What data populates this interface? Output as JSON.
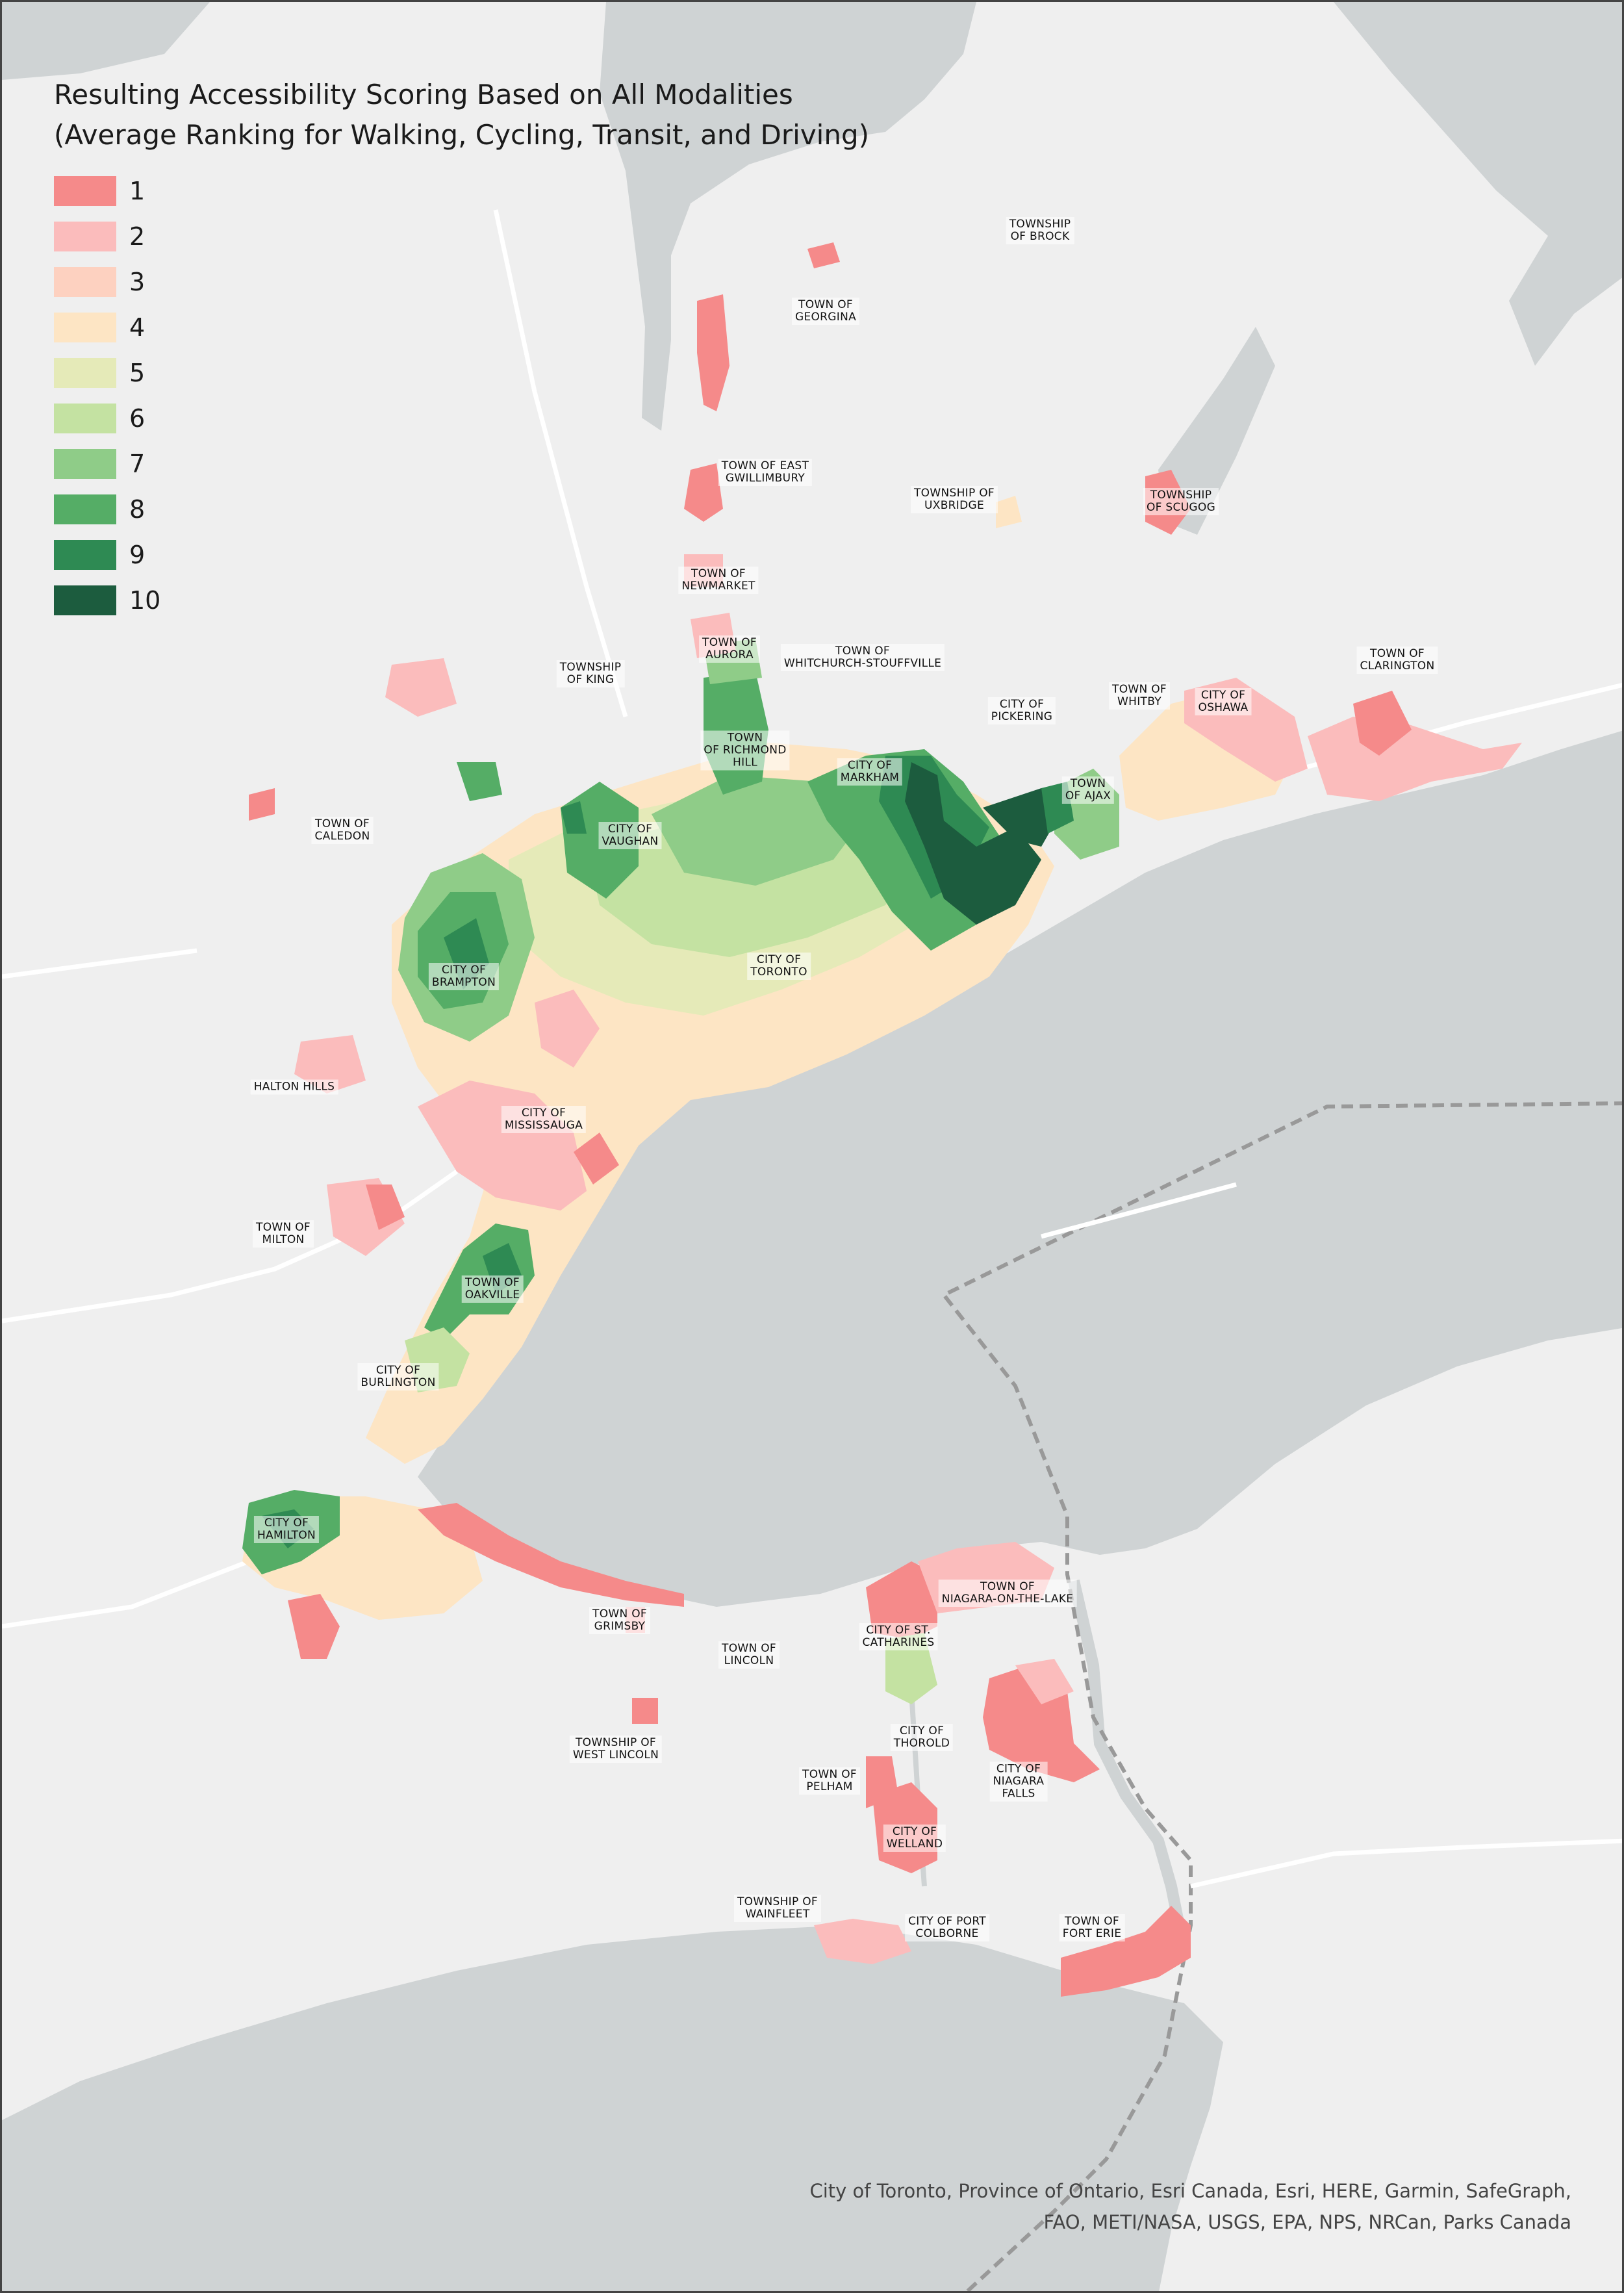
{
  "title": "Resulting Accessibility Scoring Based on All Modalities\n(Average Ranking for Walking, Cycling, Transit, and Driving)",
  "legend": [
    {
      "label": "1",
      "color": "#f58a8a"
    },
    {
      "label": "2",
      "color": "#fbbcbc"
    },
    {
      "label": "3",
      "color": "#fdd1c0"
    },
    {
      "label": "4",
      "color": "#fde5c4"
    },
    {
      "label": "5",
      "color": "#e5eab8"
    },
    {
      "label": "6",
      "color": "#c4e2a2"
    },
    {
      "label": "7",
      "color": "#8fcc88"
    },
    {
      "label": "8",
      "color": "#55ad66"
    },
    {
      "label": "9",
      "color": "#2e8a53"
    },
    {
      "label": "10",
      "color": "#1c5c3e"
    }
  ],
  "places": {
    "brock": "TOWNSHIP\nOF BROCK",
    "georgina": "TOWN OF\nGEORGINA",
    "east_gwillimbury": "TOWN OF EAST\nGWILLIMBURY",
    "uxbridge": "TOWNSHIP OF\nUXBRIDGE",
    "scugog": "TOWNSHIP\nOF SCUGOG",
    "newmarket": "TOWN OF\nNEWMARKET",
    "aurora": "TOWN OF\nAURORA",
    "whitchurch": "TOWN OF\nWHITCHURCH-STOUFFVILLE",
    "king": "TOWNSHIP\nOF KING",
    "clarington": "TOWN OF\nCLARINGTON",
    "whitby": "TOWN OF\nWHITBY",
    "oshawa": "CITY OF\nOSHAWA",
    "pickering": "CITY OF\nPICKERING",
    "richmond_hill": "TOWN\nOF RICHMOND\nHILL",
    "markham": "CITY OF\nMARKHAM",
    "ajax": "TOWN\nOF AJAX",
    "caledon": "TOWN OF\nCALEDON",
    "vaughan": "CITY OF\nVAUGHAN",
    "brampton": "CITY OF\nBRAMPTON",
    "toronto": "CITY OF\nTORONTO",
    "halton_hills": "HALTON HILLS",
    "mississauga": "CITY OF\nMISSISSAUGA",
    "milton": "TOWN OF\nMILTON",
    "oakville": "TOWN OF\nOAKVILLE",
    "burlington": "CITY OF\nBURLINGTON",
    "hamilton": "CITY OF\nHAMILTON",
    "niagara_otl": "TOWN OF\nNIAGARA-ON-THE-LAKE",
    "grimsby": "TOWN OF\nGRIMSBY",
    "lincoln": "TOWN OF\nLINCOLN",
    "st_catharines": "CITY OF ST.\nCATHARINES",
    "thorold": "CITY OF\nTHOROLD",
    "west_lincoln": "TOWNSHIP OF\nWEST LINCOLN",
    "pelham": "TOWN OF\nPELHAM",
    "niagara_falls": "CITY OF\nNIAGARA\nFALLS",
    "welland": "CITY OF\nWELLAND",
    "wainfleet": "TOWNSHIP OF\nWAINFLEET",
    "port_colborne": "CITY OF PORT\nCOLBORNE",
    "fort_erie": "TOWN OF\nFORT ERIE"
  },
  "attribution": "City of Toronto, Province of Ontario, Esri Canada, Esri, HERE, Garmin, SafeGraph,\nFAO, METI/NASA, USGS, EPA, NPS, NRCan, Parks Canada"
}
